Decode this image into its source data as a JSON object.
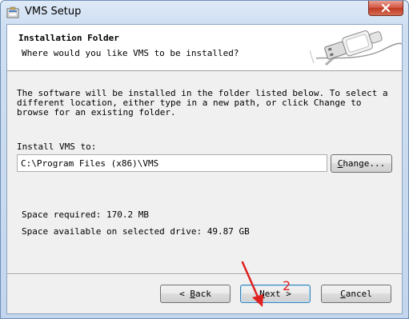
{
  "window": {
    "title": "VMS Setup",
    "icon": "installer-icon",
    "close_icon": "close-icon"
  },
  "banner": {
    "title": "Installation Folder",
    "subtitle": "Where would you like VMS to be installed?",
    "art": "usb-plug-icon"
  },
  "body": {
    "description": "The software will be installed in the folder listed below. To select a different location, either type in a new path, or click Change to browse for an existing folder.",
    "install_label": "Install VMS to:",
    "path_value": "C:\\Program Files (x86)\\VMS",
    "space_required": "Space required: 170.2 MB",
    "space_available": "Space available on selected drive: 49.87 GB"
  },
  "buttons": {
    "change_pre": "",
    "change_accel": "C",
    "change_post": "hange...",
    "back_pre": "< ",
    "back_accel": "B",
    "back_post": "ack",
    "next_accel": "N",
    "next_post": "ext >",
    "cancel_accel": "C",
    "cancel_post": "ancel"
  },
  "annotation": {
    "number": "2",
    "color": "#e02020"
  },
  "colors": {
    "title_gradient_top": "#dfeaf7",
    "client_bg": "#f0f0f0",
    "default_button_border": "#3c7fb1"
  }
}
